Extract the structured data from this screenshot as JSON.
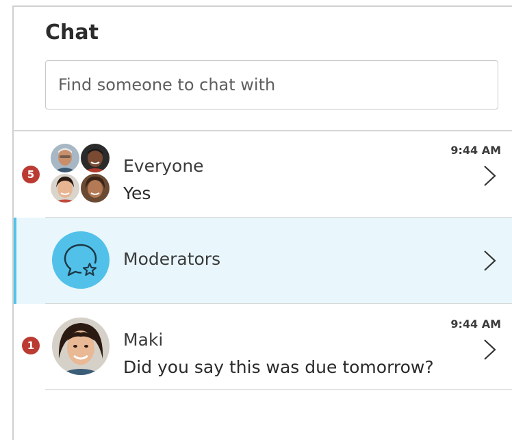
{
  "header": {
    "title": "Chat"
  },
  "search": {
    "placeholder": "Find someone to chat with"
  },
  "conversations": [
    {
      "name": "Everyone",
      "last_message": "Yes",
      "time": "9:44 AM",
      "unread": "5",
      "avatar": "group-avatars-icon"
    },
    {
      "name": "Moderators",
      "last_message": "",
      "time": "",
      "unread": "",
      "avatar": "chat-star-icon",
      "selected": true
    },
    {
      "name": "Maki",
      "last_message": "Did you say this was due tomorrow?",
      "time": "9:44 AM",
      "unread": "1",
      "avatar": "user-avatar-maki"
    }
  ],
  "colors": {
    "badge": "#bb3b33",
    "accent": "#50c3ea",
    "selected_bg": "#e9f7fc"
  }
}
